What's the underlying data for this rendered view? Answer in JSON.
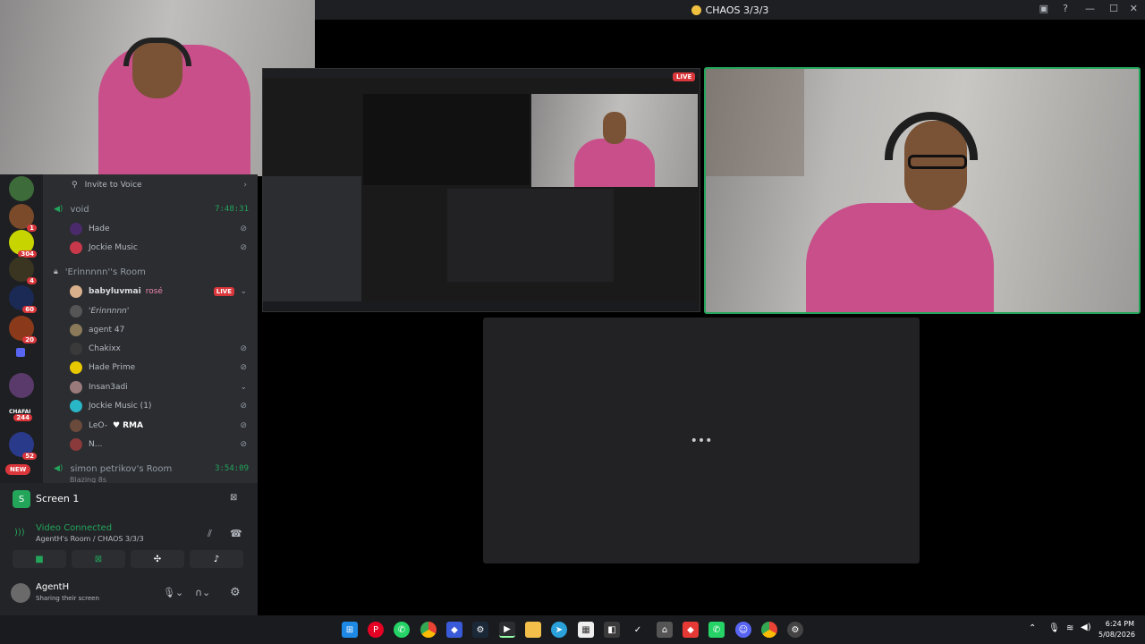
{
  "window": {
    "title": "CHAOS 3/3/3"
  },
  "servers": [
    {
      "badge": ""
    },
    {
      "badge": "1"
    },
    {
      "badge": "304"
    },
    {
      "badge": "4"
    },
    {
      "badge": "60"
    },
    {
      "badge": "20"
    },
    {
      "badge": ""
    },
    {
      "badge": ""
    },
    {
      "badge": "244"
    },
    {
      "badge": "52"
    },
    {
      "badge": "NEW"
    }
  ],
  "servers_label_chafai": "CHAFAI",
  "channels": {
    "invite": "Invite to Voice",
    "void": {
      "name": "void",
      "time": "7:48:31"
    },
    "void_users": [
      "Hade",
      "Jockie Music"
    ],
    "room1": {
      "name": "'Erinnnnn''s Room"
    },
    "room1_users": [
      "babyluvmai",
      "'Erinnnnn'",
      "agent 47",
      "Chakixx",
      "Hade Prime",
      "Insan3adi",
      "Jockie Music (1)",
      "LeO-",
      "N..."
    ],
    "babyluvmai_tag": "rosé",
    "leo_tag": "RMA",
    "live_label": "LIVE",
    "room2": {
      "name": "simon petrikov's Room",
      "time": "3:54:09",
      "sub": "Blazing 8s"
    }
  },
  "panel": {
    "screen_title": "Screen 1",
    "status": "Video Connected",
    "room": "AgentH's Room / CHAOS 3/3/3",
    "user": "AgentH",
    "user_status": "Sharing their screen"
  },
  "stage": {
    "live_label": "LIVE",
    "loading_dots": "•••"
  },
  "clock": {
    "time": "6:24 PM",
    "date": "5/08/2026"
  },
  "colors": {
    "accent_green": "#23a55a",
    "live_red": "#da373c"
  },
  "taskbar_icons": [
    "windows-icon",
    "pinterest-icon",
    "whatsapp-icon",
    "chrome-icon",
    "app-icon",
    "steam-icon",
    "terminal-icon",
    "folder-icon",
    "telegram-icon",
    "store-icon",
    "game-icon",
    "check-icon",
    "browser-icon",
    "red-app-icon",
    "whatsapp2-icon",
    "discord-icon",
    "chrome2-icon",
    "settings-icon"
  ]
}
